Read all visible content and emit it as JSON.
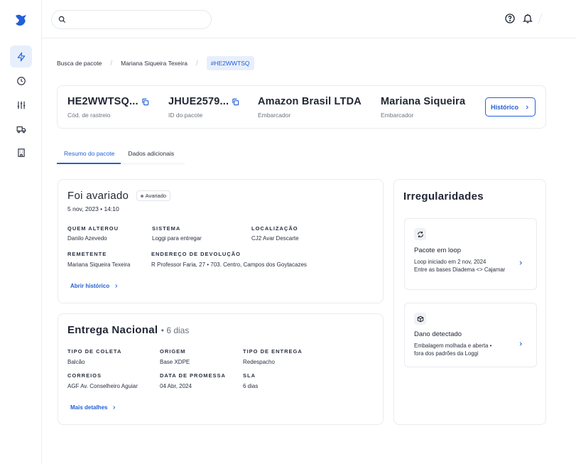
{
  "colors": {
    "accent": "#2360d6",
    "accent_bg": "#e8effc",
    "border": "#e9ebef",
    "text": "#1f2633"
  },
  "sidebar": {
    "items": [
      {
        "icon": "zap-icon",
        "active": true
      },
      {
        "icon": "clock-icon",
        "active": false
      },
      {
        "icon": "sliders-icon",
        "active": false
      },
      {
        "icon": "truck-icon",
        "active": false
      },
      {
        "icon": "building-icon",
        "active": false
      }
    ]
  },
  "topbar": {
    "search_placeholder": "",
    "icons": [
      "help-icon",
      "bell-icon"
    ]
  },
  "breadcrumb": {
    "items": [
      "Busca de pacote",
      "Mariana Siqueira Texeira",
      "#HE2WWTSQ"
    ],
    "separator": "/"
  },
  "header": {
    "tracking_code": "HE2WWTSQ...",
    "tracking_label": "Cód. de rastreio",
    "package_id": "JHUE2579...",
    "package_id_label": "ID do pacote",
    "shipper": "Amazon Brasil LTDA",
    "shipper_label": "Embarcador",
    "shipper2": "Mariana Siqueira",
    "shipper2_label": "Embarcador",
    "history_button": "Histórico"
  },
  "tabs": [
    {
      "label": "Resumo do pacote",
      "active": true
    },
    {
      "label": "Dados adicionais",
      "active": false
    }
  ],
  "damage": {
    "title": "Foi avariado",
    "badge": "Avariado",
    "datetime": "5 nov, 2023 • 14:10",
    "fields": {
      "quem_label": "QUEM ALTEROU",
      "quem_value": "Danilo Azevedo",
      "sistema_label": "SISTEMA",
      "sistema_value": "Loggi para entregar",
      "local_label": "LOCALIZAÇÃO",
      "local_value": "CJ2 Avar Descarte",
      "remetente_label": "REMETENTE",
      "remetente_value": "Mariana Siqueira Texeira",
      "endereco_label": "ENDEREÇO DE DEVOLUÇÃO",
      "endereco_value": "R Professor Faria, 27 • 703. Centro, Campos dos Goytacazes"
    },
    "link": "Abrir histórico"
  },
  "delivery": {
    "title": "Entrega Nacional",
    "duration": "• 6 dias",
    "fields": {
      "coleta_label": "TIPO DE COLETA",
      "coleta_value": "Balcão",
      "origem_label": "ORIGEM",
      "origem_value": "Base XDPE",
      "entrega_label": "TIPO DE ENTREGA",
      "entrega_value": "Redespacho",
      "correios_label": "CORREIOS",
      "correios_value": "AGF Av. Conselheiro Aguiar",
      "promessa_label": "DATA DE PROMESSA",
      "promessa_value": "04 Abr, 2024",
      "sla_label": "SLA",
      "sla_value": "6 dias"
    },
    "link": "Mais detalhes"
  },
  "irregularities": {
    "title": "Irregularidades",
    "items": [
      {
        "icon": "loop-icon",
        "title": "Pacote em loop",
        "desc1": "Loop iniciado em 2 nov, 2024",
        "desc2": "Entre as bases Diadema <> Cajamar"
      },
      {
        "icon": "package-damage-icon",
        "title": "Dano detectado",
        "desc1": "Embalagem molhada e aberta •",
        "desc2": "fora dos padrões da Loggi"
      }
    ]
  }
}
